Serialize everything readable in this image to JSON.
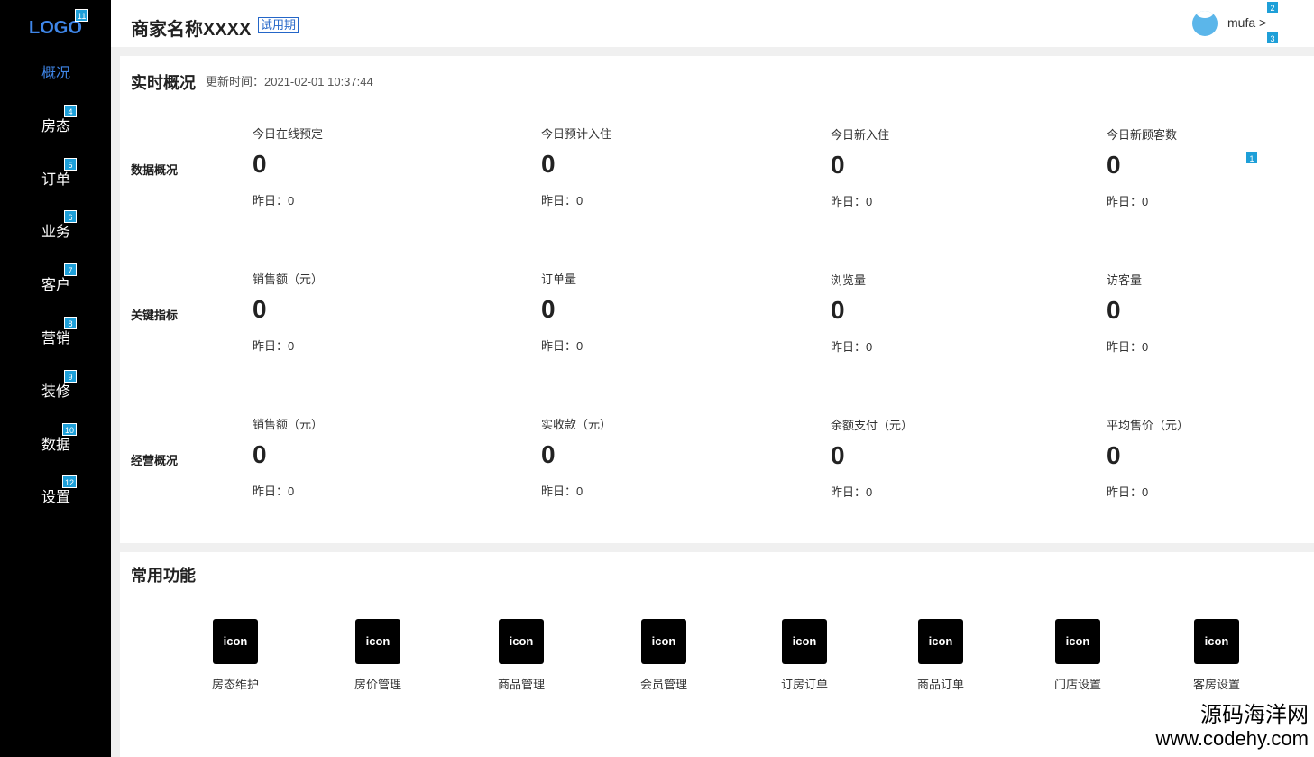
{
  "sidebar": {
    "logo": "LOGO",
    "logo_badge": "11",
    "items": [
      {
        "label": "概况",
        "badge": "",
        "active": true
      },
      {
        "label": "房态",
        "badge": "4"
      },
      {
        "label": "订单",
        "badge": "5"
      },
      {
        "label": "业务",
        "badge": "6"
      },
      {
        "label": "客户",
        "badge": "7"
      },
      {
        "label": "营销",
        "badge": "8"
      },
      {
        "label": "装修",
        "badge": "9"
      },
      {
        "label": "数据",
        "badge": "10"
      },
      {
        "label": "设置",
        "badge": "12"
      }
    ]
  },
  "header": {
    "merchant_name": "商家名称XXXX",
    "trial_tag": "试用期",
    "username": "mufa >",
    "badge_top": "2",
    "badge_bottom": "3"
  },
  "overview": {
    "title": "实时概况",
    "update_time": "更新时间：2021-02-01 10:37:44",
    "badge": "1",
    "rows": [
      {
        "label": "数据概况",
        "metrics": [
          {
            "label": "今日在线预定",
            "value": "0",
            "prev": "昨日：0"
          },
          {
            "label": "今日预计入住",
            "value": "0",
            "prev": "昨日：0"
          },
          {
            "label": "今日新入住",
            "value": "0",
            "prev": "昨日：0"
          },
          {
            "label": "今日新顾客数",
            "value": "0",
            "prev": "昨日：0"
          }
        ]
      },
      {
        "label": "关键指标",
        "metrics": [
          {
            "label": "销售额（元）",
            "value": "0",
            "prev": "昨日：0"
          },
          {
            "label": "订单量",
            "value": "0",
            "prev": "昨日：0"
          },
          {
            "label": "浏览量",
            "value": "0",
            "prev": "昨日：0"
          },
          {
            "label": "访客量",
            "value": "0",
            "prev": "昨日：0"
          }
        ]
      },
      {
        "label": "经营概况",
        "metrics": [
          {
            "label": "销售额（元）",
            "value": "0",
            "prev": "昨日：0"
          },
          {
            "label": "实收款（元）",
            "value": "0",
            "prev": "昨日：0"
          },
          {
            "label": "余额支付（元）",
            "value": "0",
            "prev": "昨日：0"
          },
          {
            "label": "平均售价（元）",
            "value": "0",
            "prev": "昨日：0"
          }
        ]
      }
    ]
  },
  "functions": {
    "title": "常用功能",
    "items": [
      {
        "icon": "icon",
        "label": "房态维护"
      },
      {
        "icon": "icon",
        "label": "房价管理"
      },
      {
        "icon": "icon",
        "label": "商品管理"
      },
      {
        "icon": "icon",
        "label": "会员管理"
      },
      {
        "icon": "icon",
        "label": "订房订单"
      },
      {
        "icon": "icon",
        "label": "商品订单"
      },
      {
        "icon": "icon",
        "label": "门店设置"
      },
      {
        "icon": "icon",
        "label": "客房设置"
      }
    ]
  },
  "watermark": {
    "line1": "源码海洋网",
    "line2": "www.codehy.com"
  }
}
